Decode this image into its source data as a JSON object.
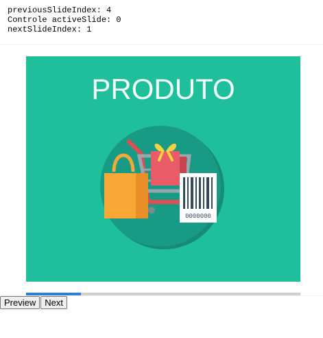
{
  "debug": {
    "previous": "previousSlideIndex: 4",
    "active": "Controle activeSlide: 0",
    "next": "nextSlideIndex: 1"
  },
  "slide": {
    "heading": "PRODUTO",
    "barcode_digits": "0000000",
    "colors": {
      "background": "#1fbf9c",
      "circle": "#199a85",
      "bag": "#f7a836",
      "gift": "#e95b66",
      "ribbon": "#f5d23f",
      "cart": "#9aa7ad",
      "handle": "#df4e55",
      "barcode": "#34495e"
    }
  },
  "progress": {
    "fraction": 0.2,
    "color": "#2e7dd1",
    "track_color": "#cfcfcf"
  },
  "controls": {
    "preview_label": "Preview",
    "next_label": "Next"
  }
}
